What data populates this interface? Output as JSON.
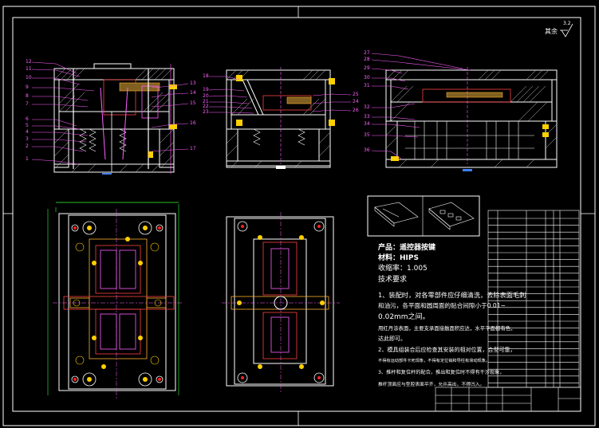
{
  "roughness": "其余",
  "roughness_value": "3.2",
  "product": {
    "name_line": "产品：遥控器按键",
    "material_line": "材料：HIPS",
    "shrink_line": "收缩率：1.005"
  },
  "tech": {
    "heading": "技术要求",
    "lines": [
      "1、装配时，对各零部件应仔细清洗，去除表面毛刺",
      "和油污，各平面和圆周面的贴合间隙小于0.01~",
      "0.02mm之间。",
      "用红丹涂表面，主要支承面接触面积应达，水平平面都有色，",
      "达此即可。",
      "2、模具组装合后应检查其安装的相对位置，合型可靠，",
      "不得有运动部件卡死现象，不得有定位销和导柱有滑动现象。",
      "3、推杆和复位杆的配合，推出和复位时不得有干涉现象，",
      "推杆顶面应与型腔表面平齐，允许高出，不得凹入。"
    ]
  },
  "callouts": {
    "left_view": [
      "12",
      "11",
      "10",
      "9",
      "8",
      "7",
      "6",
      "5",
      "4",
      "3",
      "2",
      "1"
    ],
    "left_view_right": [
      "13",
      "14",
      "15",
      "16",
      "17"
    ],
    "middle_view_left": [
      "18",
      "19",
      "20",
      "21",
      "22",
      "23"
    ],
    "middle_view_right": [
      "25",
      "24",
      "26"
    ],
    "right_view": [
      "27",
      "28",
      "29",
      "30",
      "31",
      "32",
      "33",
      "34",
      "35",
      "36"
    ]
  }
}
